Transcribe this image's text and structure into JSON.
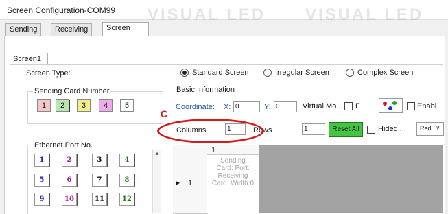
{
  "window": {
    "title": "Screen Configuration-COM99"
  },
  "watermark": {
    "text": "VISUAL LED"
  },
  "tabs": [
    {
      "label": "Sending Card"
    },
    {
      "label": "Receiving Card"
    },
    {
      "label": "Screen Connection",
      "active": true
    }
  ],
  "screen_tab": {
    "label": "Screen1"
  },
  "screen_type": {
    "label": "Screen Type:",
    "options": [
      {
        "label": "Standard Screen",
        "selected": true
      },
      {
        "label": "Irregular Screen",
        "selected": false
      },
      {
        "label": "Complex Screen",
        "selected": false
      }
    ]
  },
  "sending_card": {
    "label": "Sending Card Number",
    "buttons": [
      {
        "label": "1",
        "color": "#f7c6c6"
      },
      {
        "label": "2",
        "color": "#b9e6b0"
      },
      {
        "label": "3",
        "color": "#f2ee8a"
      },
      {
        "label": "4",
        "color": "#ecacec"
      },
      {
        "label": "5",
        "color": "#ffffff"
      }
    ]
  },
  "basic_info": {
    "label": "Basic Information",
    "coordinate_label": "Coordinate:",
    "x_label": "X:",
    "x_value": "0",
    "y_label": "Y:",
    "y_value": "0",
    "virtual_mode_label": "Virtual Mo...",
    "f_label": "F",
    "enable_label": "Enabl",
    "columns_label": "Columns",
    "columns_value": "1",
    "rows_label": "Rows",
    "rows_value": "1",
    "reset_all_label": "Reset All",
    "hided_label": "Hided ...",
    "color_select_value": "Red",
    "annotation_letter": "C",
    "annotation_color": "#d61a1a"
  },
  "ethernet": {
    "label": "Ethernet Port No.",
    "ports": [
      {
        "label": "1",
        "color": "#1a1acc"
      },
      {
        "label": "2",
        "color": "#a020a0"
      },
      {
        "label": "3",
        "color": "#111111"
      },
      {
        "label": "4",
        "color": "#1a7a1a"
      },
      {
        "label": "5",
        "color": "#1a1acc"
      },
      {
        "label": "6",
        "color": "#a020a0"
      },
      {
        "label": "7",
        "color": "#111111"
      },
      {
        "label": "8",
        "color": "#1a7a1a"
      },
      {
        "label": "9",
        "color": "#1a1acc"
      },
      {
        "label": "10",
        "color": "#a020a0"
      },
      {
        "label": "11",
        "color": "#111111"
      },
      {
        "label": "12",
        "color": "#1a7a1a"
      }
    ]
  },
  "grid": {
    "column_header": "1",
    "row_header": "1",
    "cell_text": "Sending Card: Port: Receiving Card: Width:0"
  }
}
